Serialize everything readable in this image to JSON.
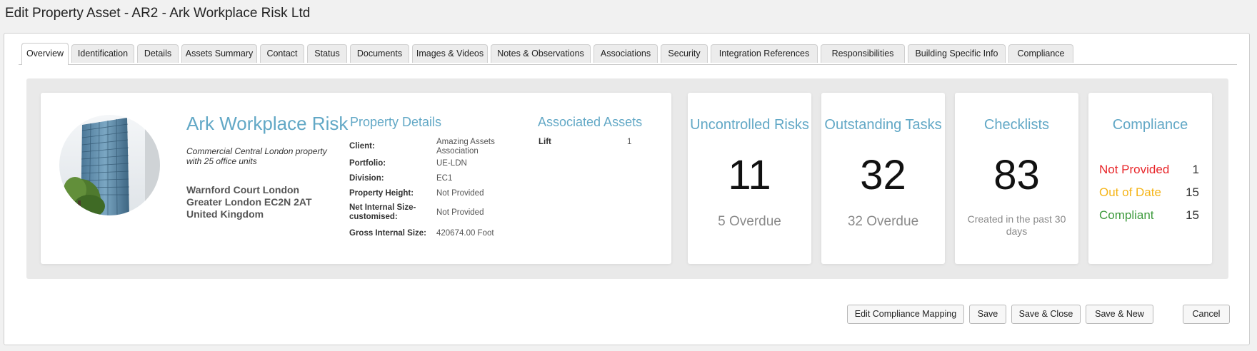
{
  "window": {
    "title": "Edit Property Asset - AR2 - Ark Workplace Risk Ltd"
  },
  "tabs": [
    {
      "label": "Overview",
      "active": true
    },
    {
      "label": "Identification"
    },
    {
      "label": "Details"
    },
    {
      "label": "Assets Summary"
    },
    {
      "label": "Contact"
    },
    {
      "label": "Status"
    },
    {
      "label": "Documents"
    },
    {
      "label": "Images & Videos"
    },
    {
      "label": "Notes & Observations"
    },
    {
      "label": "Associations"
    },
    {
      "label": "Security"
    },
    {
      "label": "Integration References"
    },
    {
      "label": "Responsibilities"
    },
    {
      "label": "Building Specific Info"
    },
    {
      "label": "Compliance"
    }
  ],
  "property": {
    "image_icon": "building-photo",
    "name": "Ark Workplace Risk",
    "description": "Commercial Central London property with 25 office units",
    "address": "Warnford Court London Greater London EC2N 2AT United Kingdom"
  },
  "property_details": {
    "heading": "Property Details",
    "rows": [
      {
        "label": "Client:",
        "value": "Amazing Assets Association"
      },
      {
        "label": "Portfolio:",
        "value": "UE-LDN"
      },
      {
        "label": "Division:",
        "value": "EC1"
      },
      {
        "label": "Property Height:",
        "value": "Not Provided"
      },
      {
        "label": "Net Internal Size-customised:",
        "value": "Not Provided"
      },
      {
        "label": "Gross Internal Size:",
        "value": "420674.00 Foot"
      }
    ]
  },
  "associated_assets": {
    "heading": "Associated Assets",
    "rows": [
      {
        "label": "Lift",
        "value": "1"
      }
    ]
  },
  "stats": {
    "uncontrolled_risks": {
      "title": "Uncontrolled Risks",
      "value": "11",
      "sub": "5 Overdue"
    },
    "outstanding_tasks": {
      "title": "Outstanding Tasks",
      "value": "32",
      "sub": "32 Overdue"
    },
    "checklists": {
      "title": "Checklists",
      "value": "83",
      "sub": "Created in the past 30 days"
    }
  },
  "compliance": {
    "title": "Compliance",
    "rows": [
      {
        "label": "Not Provided",
        "count": "1",
        "color": "#e8262a"
      },
      {
        "label": "Out of Date",
        "count": "15",
        "color": "#f5b417"
      },
      {
        "label": "Compliant",
        "count": "15",
        "color": "#3d9a3c"
      }
    ]
  },
  "colors": {
    "accent": "#62a8c6"
  },
  "buttons": {
    "edit_compliance_mapping": "Edit Compliance Mapping",
    "save": "Save",
    "save_close": "Save & Close",
    "save_new": "Save & New",
    "cancel": "Cancel"
  }
}
